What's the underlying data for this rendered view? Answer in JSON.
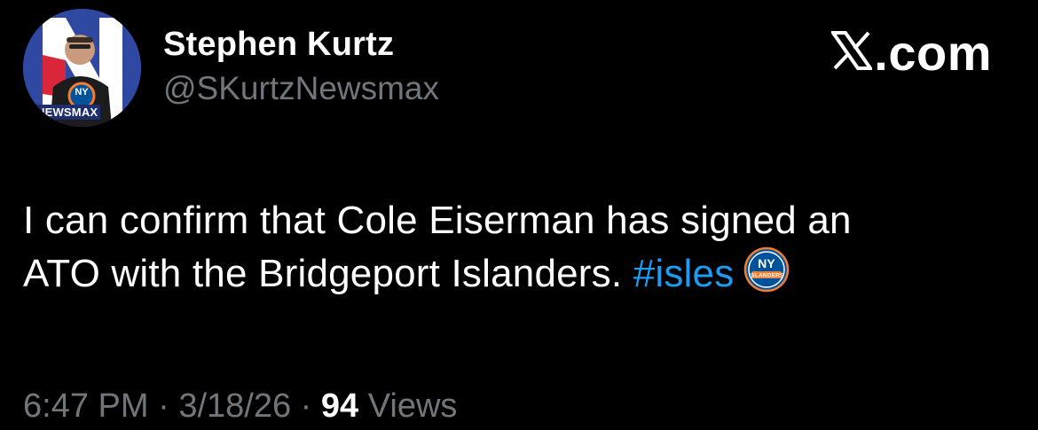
{
  "author": {
    "display_name": "Stephen Kurtz",
    "handle": "@SKurtzNewsmax",
    "avatar_badge_text": "NEWSMAX",
    "avatar_logo_text": "NY"
  },
  "brand": {
    "label": ".com",
    "icon": "x-logo-icon"
  },
  "tweet": {
    "line1": "I can confirm that Cole Eiserman has signed an",
    "line2_text": "ATO with the Bridgeport Islanders.",
    "hashtag": "#isles",
    "hashtag_emoji": "islanders-logo-icon",
    "emoji_logo_text": "NY",
    "emoji_wordmark_text": "ISLANDERS"
  },
  "meta": {
    "time": "6:47 PM",
    "separator": "·",
    "date": "3/18/26",
    "views_count": "94",
    "views_label": "Views"
  },
  "colors": {
    "background": "#000000",
    "text": "#ffffff",
    "secondary": "#71767b",
    "link": "#1d9bf0",
    "islanders_blue": "#00539b",
    "islanders_orange": "#f47d30"
  }
}
